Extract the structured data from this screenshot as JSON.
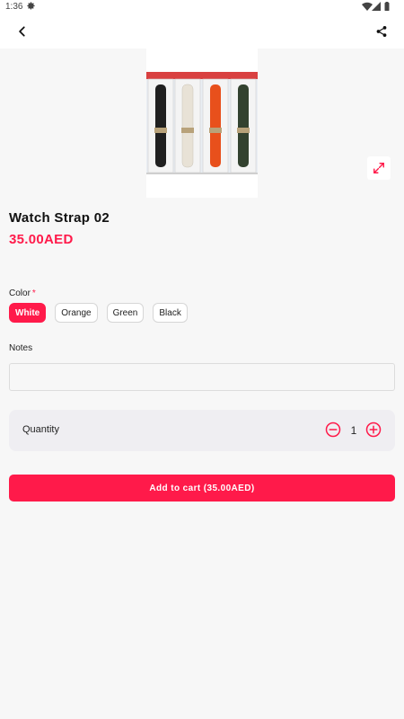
{
  "status_bar": {
    "time": "1:36"
  },
  "product": {
    "title": "Watch Strap 02",
    "price": "35.00AED",
    "image_alt": "watch straps",
    "strap_colors": [
      "#1f1f1f",
      "#e8e2d6",
      "#e8501c",
      "#33422f"
    ]
  },
  "color_option": {
    "label": "Color",
    "required_mark": "*",
    "options": [
      "White",
      "Orange",
      "Green",
      "Black"
    ],
    "selected": "White"
  },
  "notes": {
    "label": "Notes",
    "value": "",
    "placeholder": ""
  },
  "quantity": {
    "label": "Quantity",
    "value": "1"
  },
  "add_to_cart": {
    "label": "Add to cart (35.00AED)"
  },
  "colors": {
    "accent": "#ff1a4a",
    "background": "#f7f7f7",
    "card": "#efeef2"
  },
  "icons": {
    "back": "chevron-left-icon",
    "share": "share-icon",
    "expand": "expand-icon",
    "minus": "minus-circle-icon",
    "plus": "plus-circle-icon"
  }
}
